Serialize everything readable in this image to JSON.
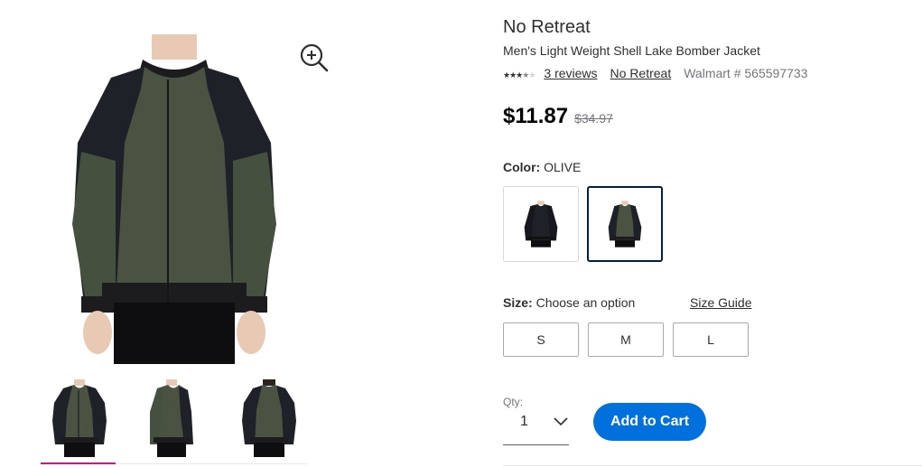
{
  "product": {
    "brand": "No Retreat",
    "name": "Men's Light Weight Shell Lake Bomber Jacket",
    "rating": {
      "stars": 3.5,
      "max": 5,
      "reviews_label": "3 reviews"
    },
    "brand_link": "No Retreat",
    "walmart_number": "Walmart # 565597733"
  },
  "price": {
    "current": "$11.87",
    "was": "$34.97"
  },
  "color": {
    "label": "Color:",
    "value": "OLIVE",
    "options": [
      "black",
      "olive"
    ],
    "selected": "olive"
  },
  "size": {
    "label": "Size:",
    "prompt": "Choose an option",
    "guide_label": "Size Guide",
    "options": [
      "S",
      "M",
      "L"
    ]
  },
  "quantity": {
    "label": "Qty:",
    "value": "1"
  },
  "cart": {
    "button_label": "Add to Cart"
  },
  "colors": {
    "olive": "#4a5242",
    "black": "#1e2128",
    "accent_blue": "#0071dc",
    "thumb_indicator": "#c21d7c",
    "selected_border": "#041e42"
  },
  "icons": {
    "zoom": "zoom-in-icon",
    "qty_chevron": "chevron-down-icon"
  }
}
